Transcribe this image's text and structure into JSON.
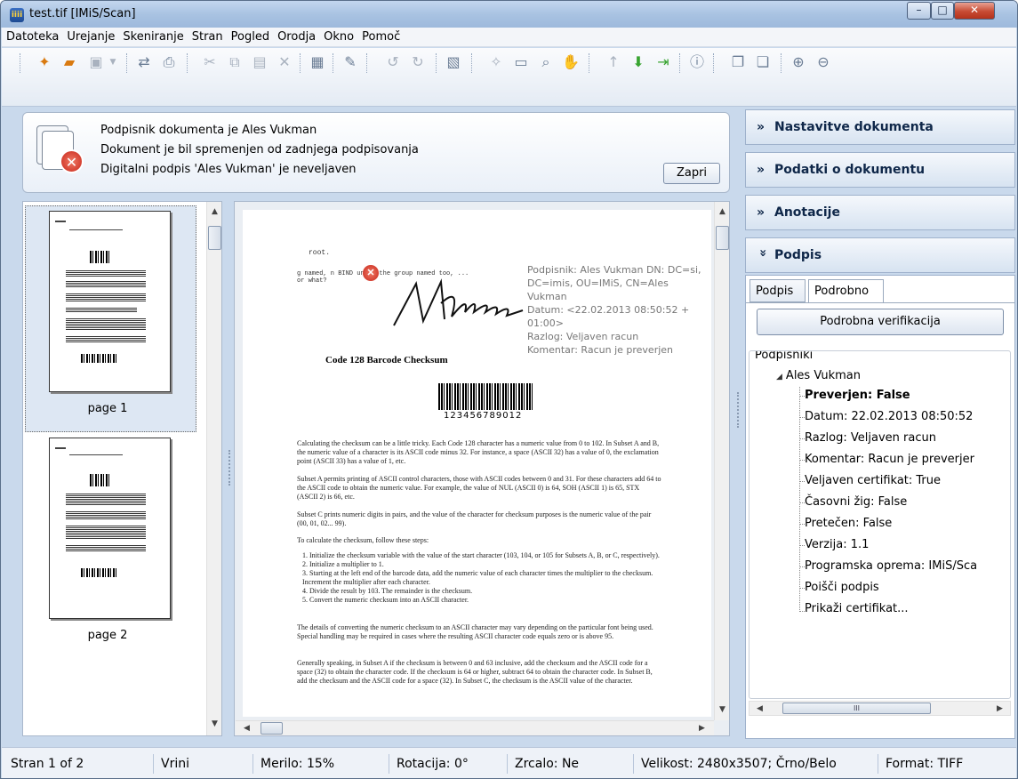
{
  "window": {
    "title": "test.tif [IMiS/Scan]",
    "icon": "app-logo-icon",
    "buttons": {
      "minimize": "–",
      "maximize": "□",
      "close": "✕"
    }
  },
  "menu": {
    "items": [
      "Datoteka",
      "Urejanje",
      "Skeniranje",
      "Stran",
      "Pogled",
      "Orodja",
      "Okno",
      "Pomoč"
    ]
  },
  "toolbar": {
    "icons": [
      "new-document-icon",
      "open-folder-icon",
      "save-icon",
      "scan-icon",
      "print-icon",
      "cut-icon",
      "copy-icon",
      "paste-icon",
      "delete-icon",
      "properties-icon",
      "edit-icon",
      "rotate-left-icon",
      "rotate-right-icon",
      "layers-icon",
      "erase-icon",
      "fit-page-icon",
      "zoom-icon",
      "hand-icon",
      "arrow-up-icon",
      "arrow-down-icon",
      "insert-icon",
      "info-icon",
      "window-single-icon",
      "window-cascade-icon",
      "zoom-in-icon",
      "zoom-out-icon"
    ]
  },
  "notice": {
    "line1": "Podpisnik dokumenta je  Ales Vukman",
    "line2": "Dokument je bil spremenjen od zadnjega podpisovanja",
    "line3": "Digitalni podpis 'Ales Vukman' je neveljaven",
    "close_label": "Zapri"
  },
  "thumbnails": {
    "pages": [
      {
        "label": "page 1",
        "selected": true
      },
      {
        "label": "page 2",
        "selected": false
      }
    ]
  },
  "document": {
    "head_line1": "root.",
    "head_line2": "g named,     n BIND under the group named too, ...",
    "head_line3": "or what?",
    "signature_overlay": "Podpisnik: Ales Vukman DN: DC=si, DC=imis, OU=IMiS, CN=Ales Vukman\nDatum: <22.02.2013 08:50:52 + 01:00>\nRazlog: Veljaven racun\nKomentar: Racun je preverjen",
    "heading": "Code 128 Barcode Checksum",
    "barcode_text": "123456789012",
    "paragraphs": [
      "Calculating the checksum can be a little tricky. Each Code 128 character has a numeric value from 0 to 102. In Subset A and B, the numeric value of a character is its ASCII code minus 32. For instance, a space (ASCII 32) has a value of 0, the exclamation point (ASCII 33) has a value of 1, etc.",
      "Subset A permits printing of ASCII control characters, those with ASCII codes between 0 and 31. For these characters add 64 to the ASCII code to obtain the numeric value. For example, the value of NUL (ASCII 0) is 64, SOH (ASCII 1) is 65, STX (ASCII 2) is 66, etc.",
      "Subset C prints numeric digits in pairs, and the value of the character for checksum purposes is the numeric value of the pair (00, 01, 02... 99).",
      "To calculate the checksum, follow these steps:",
      "1. Initialize the checksum variable with the value of the start character (103, 104, or 105 for Subsets A, B, or C, respectively).\n2. Initialize a multiplier to 1.\n3. Starting at the left end of the barcode data, add the numeric value of each character times the multiplier to the checksum. Increment the multiplier after each character.\n4. Divide the result by 103. The remainder is the checksum.\n5. Convert the numeric checksum into an ASCII character.",
      "The details of converting the numeric checksum to an ASCII character may vary depending on the particular font being used. Special handling may be required in cases where the resulting ASCII character code equals zero or is above 95.",
      "Generally speaking, in Subset A if the checksum is between 0 and 63 inclusive, add the checksum and the ASCII code for a space (32) to obtain the character code. If the checksum is 64 or higher, subtract 64 to obtain the character code. In Subset B, add the checksum and the ASCII code for a space (32). In Subset C, the checksum is the ASCII value of the character."
    ]
  },
  "sidepanel": {
    "sections": [
      {
        "label": "Nastavitve dokumenta",
        "chevron": "»"
      },
      {
        "label": "Podatki o dokumentu",
        "chevron": "»"
      },
      {
        "label": "Anotacije",
        "chevron": "»"
      },
      {
        "label": "Podpis",
        "chevron": "»"
      }
    ],
    "tabs": [
      "Podpis",
      "Podrobno"
    ],
    "verify_button": "Podrobna verifikacija",
    "group_title": "Podpisniki",
    "tree_root": "Ales Vukman",
    "tree_items": [
      "Preverjen: False",
      "Datum: 22.02.2013 08:50:52",
      "Razlog: Veljaven racun",
      "Komentar: Racun je preverjer",
      "Veljaven certifikat: True",
      "Časovni žig: False",
      "Pretečen: False",
      "Verzija: 1.1",
      "Programska oprema: IMiS/Sca",
      "Poišči podpis",
      "Prikaži certifikat..."
    ],
    "scroll_grip": "III"
  },
  "status": {
    "page": "Stran 1 of 2",
    "mode": "Vrini",
    "zoom": "Merilo: 15%",
    "rotation": "Rotacija: 0°",
    "mirror": "Zrcalo: Ne",
    "size": "Velikost: 2480x3507; Črno/Belo",
    "format": "Format: TIFF"
  }
}
